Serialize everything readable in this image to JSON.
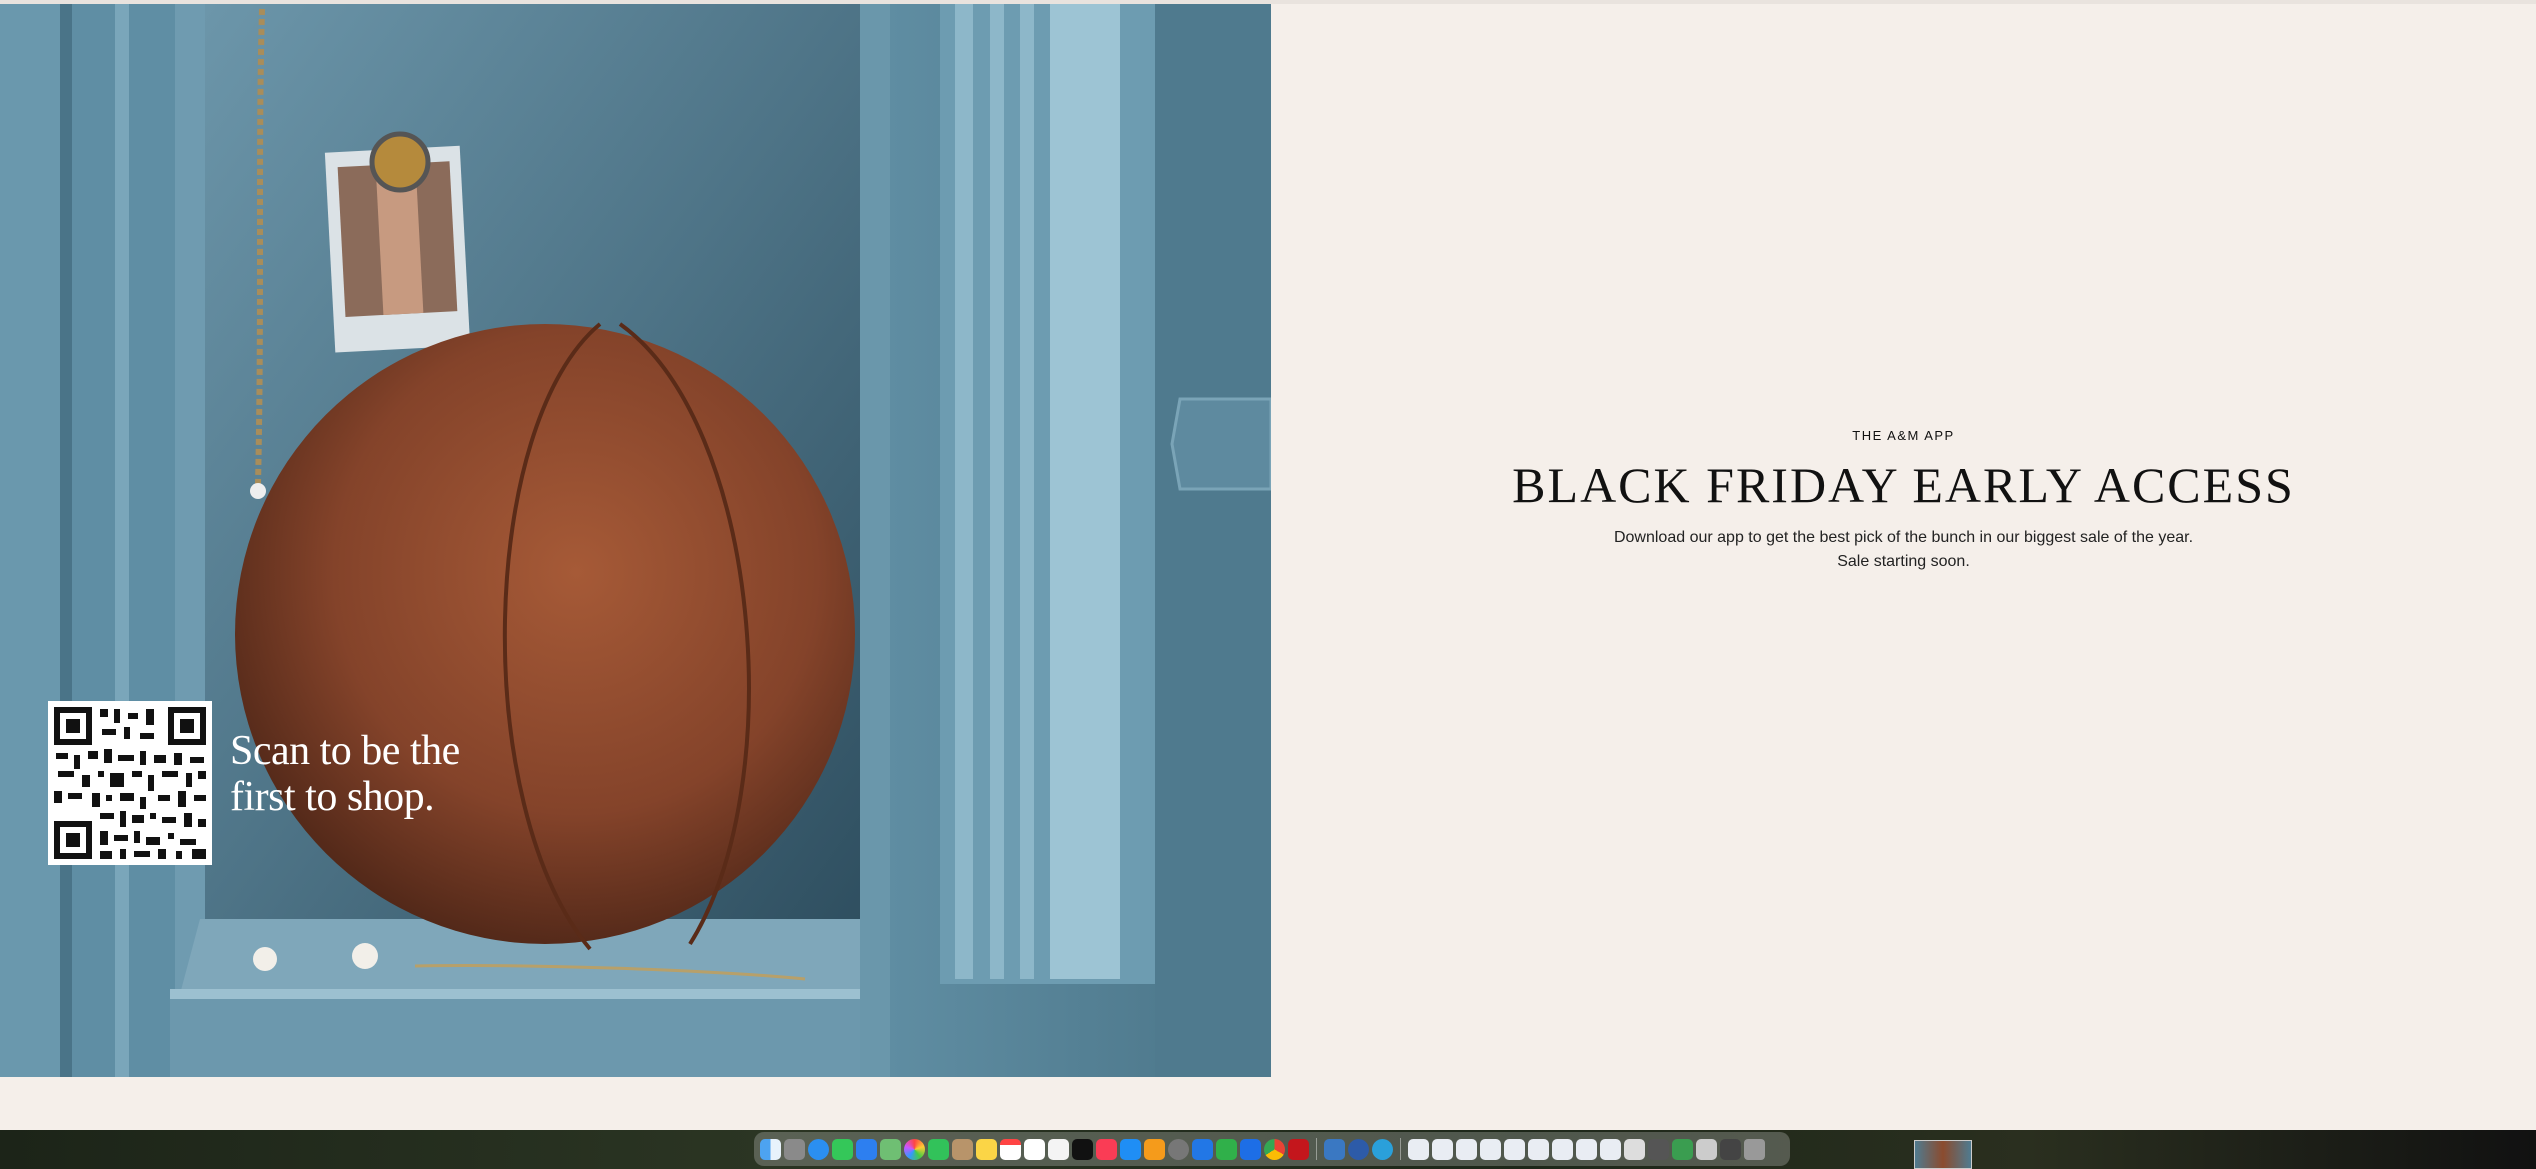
{
  "hero": {
    "qr_caption": "Scan to be the first to shop."
  },
  "content": {
    "eyebrow": "THE A&M APP",
    "headline": "BLACK FRIDAY EARLY ACCESS",
    "description_line1": "Download our app to get the best pick of the bunch in our biggest sale of the year.",
    "description_line2": "Sale starting soon."
  },
  "dock": {
    "apps": [
      "finder-icon",
      "launchpad-icon",
      "safari-icon",
      "messages-icon",
      "mail-icon",
      "maps-icon",
      "photos-icon",
      "facetime-icon",
      "contacts-icon",
      "notes-icon",
      "calendar-icon",
      "reminders-icon",
      "freeform-icon",
      "tv-icon",
      "music-icon",
      "appstore-icon",
      "pages-icon",
      "settings-icon",
      "keynote-icon",
      "numbers-icon",
      "xcode-icon",
      "chrome-icon",
      "acrobat-icon",
      "preview-icon",
      "quicktime-icon",
      "telegram-icon"
    ],
    "docs_count": 14
  },
  "colors": {
    "page_bg": "#f5efea",
    "locker_blue": "#4f7b90",
    "ball_brown": "#8b4b2e",
    "text_dark": "#111111"
  }
}
